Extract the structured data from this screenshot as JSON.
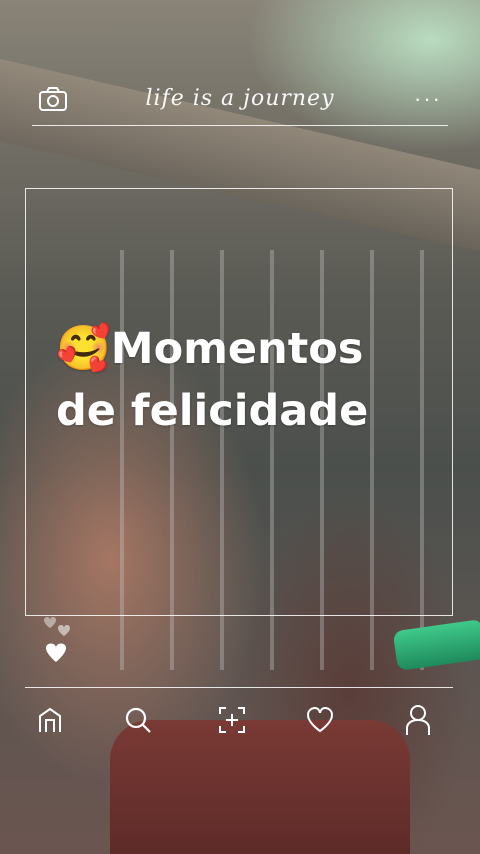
{
  "header": {
    "brand_text": "life is a journey",
    "camera_icon": "camera-icon",
    "more_icon": "more-icon",
    "more_symbol": "···"
  },
  "caption": {
    "emoji": "🥰",
    "line1": "Momentos",
    "line2": "de felicidade"
  },
  "bottom_nav": {
    "items": [
      "home-icon",
      "search-icon",
      "add-icon",
      "heart-icon",
      "profile-icon"
    ]
  },
  "colors": {
    "overlay": "#ffffff"
  }
}
